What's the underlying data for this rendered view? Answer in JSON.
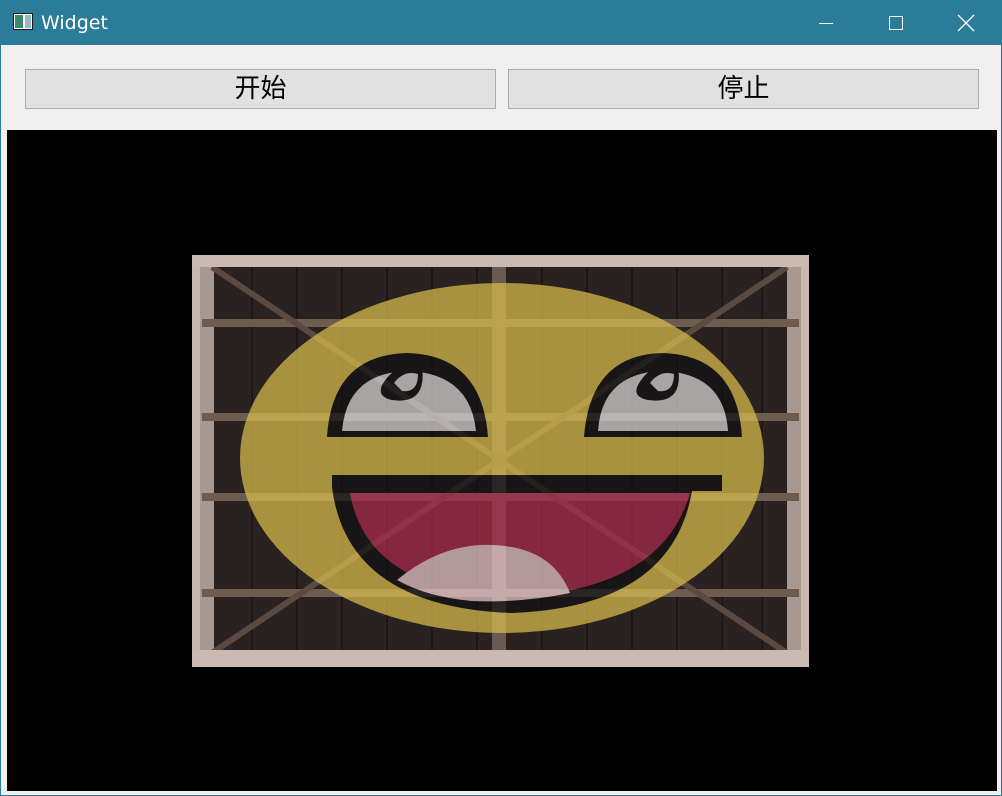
{
  "window": {
    "title": "Widget",
    "titlebar_color": "#2b7c98"
  },
  "toolbar": {
    "start_label": "开始",
    "stop_label": "停止"
  },
  "icons": {
    "app": "window-icon",
    "minimize": "minimize-icon",
    "maximize": "maximize-icon",
    "close": "close-icon"
  },
  "canvas": {
    "background": "#000000",
    "content": "awesome-face-on-wooden-crate-image"
  }
}
